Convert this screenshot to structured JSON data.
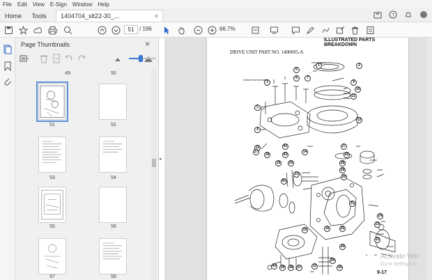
{
  "menubar": {
    "items": [
      "File",
      "Edit",
      "View",
      "E-Sign",
      "Window",
      "Help"
    ]
  },
  "tabs": {
    "home": "Home",
    "tools": "Tools",
    "doc": "1404704_slt22-30_...",
    "close": "×"
  },
  "toolbar": {
    "page_current": "51",
    "page_total": "/ 196",
    "zoom": "66.7%"
  },
  "panel": {
    "title": "Page Thumbnails",
    "close": "×",
    "zoom_level": 0.45,
    "thumbnails": [
      {
        "label": "49"
      },
      {
        "label": "50"
      },
      {
        "label": "51"
      },
      {
        "label": "52"
      },
      {
        "label": "53"
      },
      {
        "label": "54"
      },
      {
        "label": "55"
      },
      {
        "label": "56"
      },
      {
        "label": "57"
      },
      {
        "label": "58"
      }
    ]
  },
  "document": {
    "header": "ILLUSTRATED PARTS BREAKDOWN",
    "title": "DRIVE UNIT PART NO. 1400695-A",
    "view_note": "(View from beneath)",
    "page_number": "9-17",
    "callouts": [
      "1",
      "2",
      "3",
      "4",
      "5",
      "6",
      "7",
      "8",
      "9",
      "10",
      "11",
      "12",
      "13",
      "14",
      "16",
      "17",
      "18",
      "19",
      "20",
      "21",
      "22",
      "23",
      "24",
      "25",
      "26",
      "27",
      "28",
      "29",
      "30",
      "31",
      "32",
      "33",
      "34",
      "35",
      "36",
      "37",
      "38",
      "39",
      "40",
      "41",
      "42",
      "43"
    ]
  },
  "watermark": {
    "line1": "Activate Win",
    "line2": "Go to Settings to"
  }
}
